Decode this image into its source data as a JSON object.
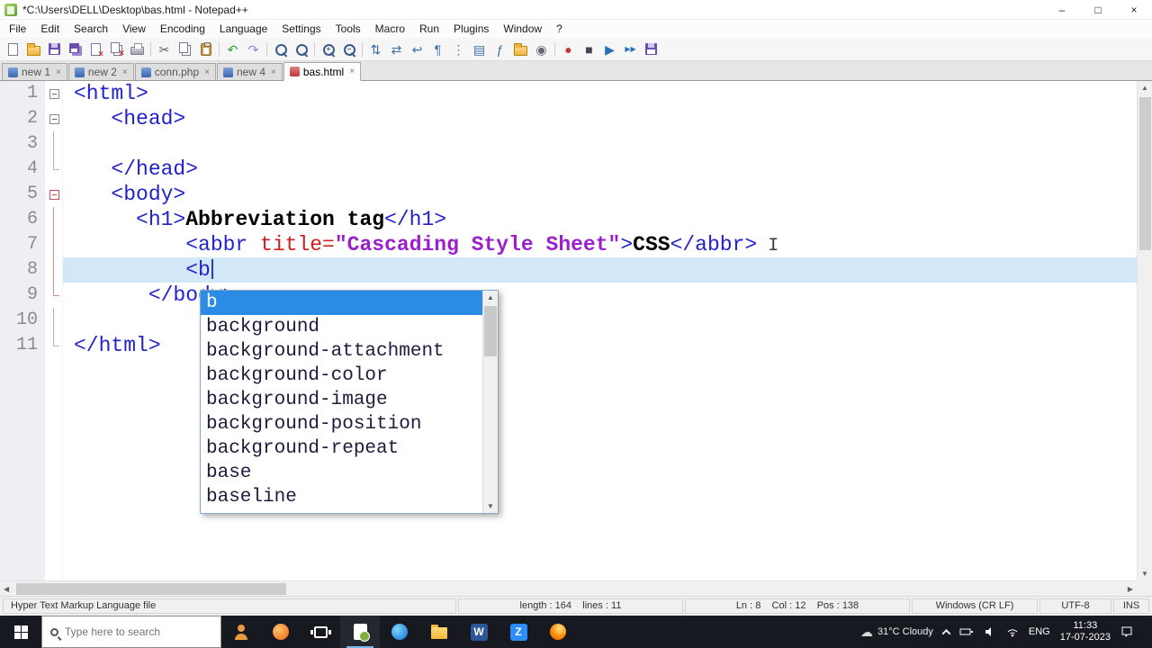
{
  "window": {
    "title": "*C:\\Users\\DELL\\Desktop\\bas.html - Notepad++",
    "minimize_glyph": "–",
    "maximize_glyph": "□",
    "close_glyph": "×"
  },
  "menubar": {
    "items": [
      "File",
      "Edit",
      "Search",
      "View",
      "Encoding",
      "Language",
      "Settings",
      "Tools",
      "Macro",
      "Run",
      "Plugins",
      "Window",
      "?"
    ]
  },
  "toolbar": {
    "icons": [
      {
        "name": "new-file-button",
        "kind": "sheet"
      },
      {
        "name": "open-file-button",
        "kind": "folder"
      },
      {
        "name": "save-button",
        "kind": "floppy"
      },
      {
        "name": "save-all-button",
        "kind": "floppy2"
      },
      {
        "name": "close-file-button",
        "kind": "sheet-x"
      },
      {
        "name": "close-all-button",
        "kind": "sheet-x2"
      },
      {
        "name": "print-button",
        "kind": "printer"
      },
      {
        "name": "sep"
      },
      {
        "name": "cut-button",
        "kind": "glyph",
        "g": "✂",
        "c": "#556066"
      },
      {
        "name": "copy-button",
        "kind": "copy"
      },
      {
        "name": "paste-button",
        "kind": "paste"
      },
      {
        "name": "sep"
      },
      {
        "name": "undo-button",
        "kind": "glyph",
        "g": "↶",
        "c": "#2f9e2f"
      },
      {
        "name": "redo-button",
        "kind": "glyph",
        "g": "↷",
        "c": "#8888d8"
      },
      {
        "name": "sep"
      },
      {
        "name": "find-button",
        "kind": "mag"
      },
      {
        "name": "replace-button",
        "kind": "mag"
      },
      {
        "name": "sep"
      },
      {
        "name": "zoom-in-button",
        "kind": "mag-plus"
      },
      {
        "name": "zoom-out-button",
        "kind": "mag-minus"
      },
      {
        "name": "sep"
      },
      {
        "name": "sync-vertical-button",
        "kind": "glyph",
        "g": "⇅",
        "c": "#3a6ea5"
      },
      {
        "name": "sync-horizontal-button",
        "kind": "glyph",
        "g": "⇄",
        "c": "#3a6ea5"
      },
      {
        "name": "word-wrap-button",
        "kind": "glyph",
        "g": "↩",
        "c": "#3a6ea5"
      },
      {
        "name": "show-all-characters-button",
        "kind": "glyph",
        "g": "¶",
        "c": "#3a6ea5"
      },
      {
        "name": "indent-guide-button",
        "kind": "glyph",
        "g": "⋮",
        "c": "#667"
      },
      {
        "name": "document-map-button",
        "kind": "glyph",
        "g": "▤",
        "c": "#3a6ea5"
      },
      {
        "name": "function-list-button",
        "kind": "glyph",
        "g": "ƒ",
        "c": "#3a6ea5"
      },
      {
        "name": "folder-as-workspace-button",
        "kind": "folder"
      },
      {
        "name": "monitoring-button",
        "kind": "glyph",
        "g": "◉",
        "c": "#667"
      },
      {
        "name": "sep"
      },
      {
        "name": "record-macro-button",
        "kind": "glyph",
        "g": "●",
        "c": "#c23a3a"
      },
      {
        "name": "stop-macro-button",
        "kind": "glyph",
        "g": "■",
        "c": "#454555"
      },
      {
        "name": "playback-macro-button",
        "kind": "glyph",
        "g": "▶",
        "c": "#2d6fb5"
      },
      {
        "name": "run-macro-multiple-button",
        "kind": "glyph",
        "g": "▶▶",
        "c": "#2d6fb5"
      },
      {
        "name": "save-macro-button",
        "kind": "floppy"
      }
    ]
  },
  "tabbar": {
    "close_glyph": "×",
    "tabs": [
      {
        "label": "new 1",
        "state": "saved"
      },
      {
        "label": "new 2",
        "state": "saved"
      },
      {
        "label": "conn.php",
        "state": "saved"
      },
      {
        "label": "new 4",
        "state": "saved"
      },
      {
        "label": "bas.html",
        "state": "modified",
        "active": true
      }
    ]
  },
  "editor": {
    "lines": [
      {
        "n": 1,
        "fold": "box",
        "tokens": [
          {
            "t": "tag",
            "x": "<html>"
          }
        ]
      },
      {
        "n": 2,
        "fold": "box",
        "tokens": [
          {
            "t": "tag",
            "x": "   <head>"
          }
        ]
      },
      {
        "n": 3,
        "fold": "bar",
        "tokens": []
      },
      {
        "n": 4,
        "fold": "end",
        "tokens": [
          {
            "t": "tag",
            "x": "   </head>"
          }
        ]
      },
      {
        "n": 5,
        "fold": "box-hot",
        "tokens": [
          {
            "t": "tag",
            "x": "   <body>"
          }
        ]
      },
      {
        "n": 6,
        "fold": "bar-hot",
        "tokens": [
          {
            "t": "tag",
            "x": "     <h1>"
          },
          {
            "t": "txt",
            "x": "Abbreviation tag"
          },
          {
            "t": "tag",
            "x": "</h1>"
          }
        ]
      },
      {
        "n": 7,
        "fold": "bar-hot",
        "tokens": [
          {
            "t": "tag",
            "x": "         <abbr "
          },
          {
            "t": "attr",
            "x": "title="
          },
          {
            "t": "str",
            "x": "\"Cascading Style Sheet\""
          },
          {
            "t": "tag",
            "x": ">"
          },
          {
            "t": "txt",
            "x": "CSS"
          },
          {
            "t": "tag",
            "x": "</abbr>"
          },
          {
            "t": "ibeam",
            "x": " I"
          }
        ]
      },
      {
        "n": 8,
        "fold": "bar-hot",
        "current": true,
        "tokens": [
          {
            "t": "tag",
            "x": "         <b"
          },
          {
            "t": "caret",
            "x": ""
          }
        ]
      },
      {
        "n": 9,
        "fold": "end-hot",
        "tokens": [
          {
            "t": "tag",
            "x": "      </body>"
          }
        ]
      },
      {
        "n": 10,
        "fold": "bar",
        "tokens": []
      },
      {
        "n": 11,
        "fold": "end",
        "tokens": [
          {
            "t": "tag",
            "x": "</html>"
          }
        ]
      }
    ]
  },
  "autocomplete": {
    "selected_index": 0,
    "items": [
      "b",
      "background",
      "background-attachment",
      "background-color",
      "background-image",
      "background-position",
      "background-repeat",
      "base",
      "baseline"
    ]
  },
  "statusbar": {
    "doc_type": "Hyper Text Markup Language file",
    "length_info": "length : 164    lines : 11",
    "caret_info": "Ln : 8    Col : 12    Pos : 138",
    "eol_format": "Windows (CR LF)",
    "encoding": "UTF-8",
    "typing_mode": "INS"
  },
  "taskbar": {
    "search_placeholder": "Type here to search",
    "icons": [
      {
        "name": "people-icon",
        "kind": "people"
      },
      {
        "name": "browser-orange-icon",
        "kind": "circle-orange"
      },
      {
        "name": "task-view-icon",
        "kind": "taskview"
      },
      {
        "name": "notepadpp-taskbar-icon",
        "kind": "npp",
        "active": true
      },
      {
        "name": "edge-icon",
        "kind": "circle-blue"
      },
      {
        "name": "file-explorer-icon",
        "kind": "explorer"
      },
      {
        "name": "word-icon",
        "kind": "letter",
        "letter": "W",
        "bg": "#2b579a"
      },
      {
        "name": "zoom-icon",
        "kind": "letter",
        "letter": "Z",
        "bg": "#2d8cff"
      },
      {
        "name": "firefox-icon",
        "kind": "circle-fox"
      }
    ],
    "tray": {
      "weather_icon": "☁",
      "weather": "31°C Cloudy",
      "language": "ENG",
      "time": "11:33",
      "date": "17-07-2023"
    }
  },
  "colors": {
    "tag": "#2222cc",
    "attribute": "#cc2020",
    "string": "#9b20cc",
    "bold_text": "#000000",
    "current_line": "#d2e8f8",
    "selection": "#2b8ce6",
    "taskbar_bg": "#16191f"
  }
}
